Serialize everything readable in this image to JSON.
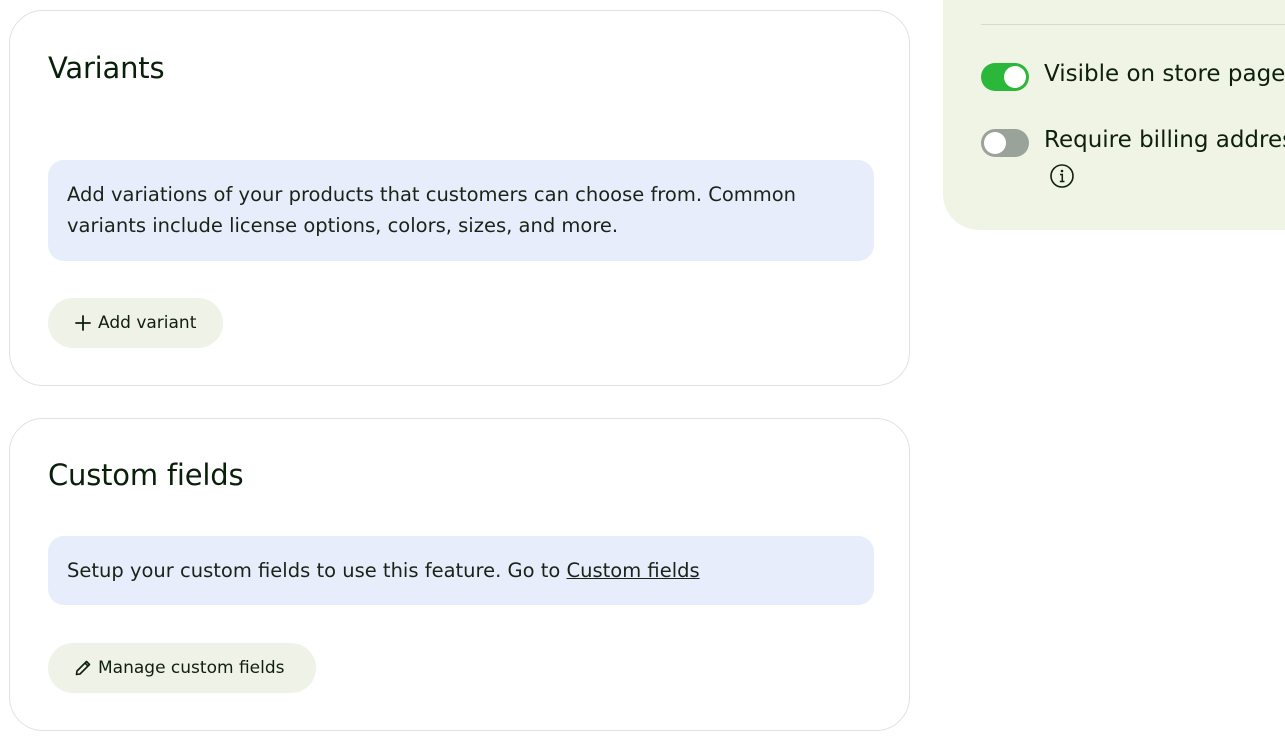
{
  "variants": {
    "title": "Variants",
    "description": "Add variations of your products that customers can choose from. Common variants include license options, colors, sizes, and more.",
    "add_button_icon": "plus-icon",
    "add_button_label": "Add variant"
  },
  "custom_fields": {
    "title": "Custom fields",
    "description_prefix": "Setup your custom fields to use this feature. Go to ",
    "link_label": "Custom fields",
    "manage_button_icon": "pencil-icon",
    "manage_button_label": "Manage custom fields"
  },
  "side_settings": {
    "visible_label": "Visible on store page",
    "visible_on": true,
    "billing_label": "Require billing address",
    "billing_on": false,
    "info_icon": "info-icon"
  },
  "colors": {
    "toggle_on": "#2bb83a",
    "toggle_off": "#9aa39a",
    "info_box_bg": "#e8edfc",
    "button_bg": "#eff2e6",
    "side_panel_bg": "#eff4e5"
  }
}
